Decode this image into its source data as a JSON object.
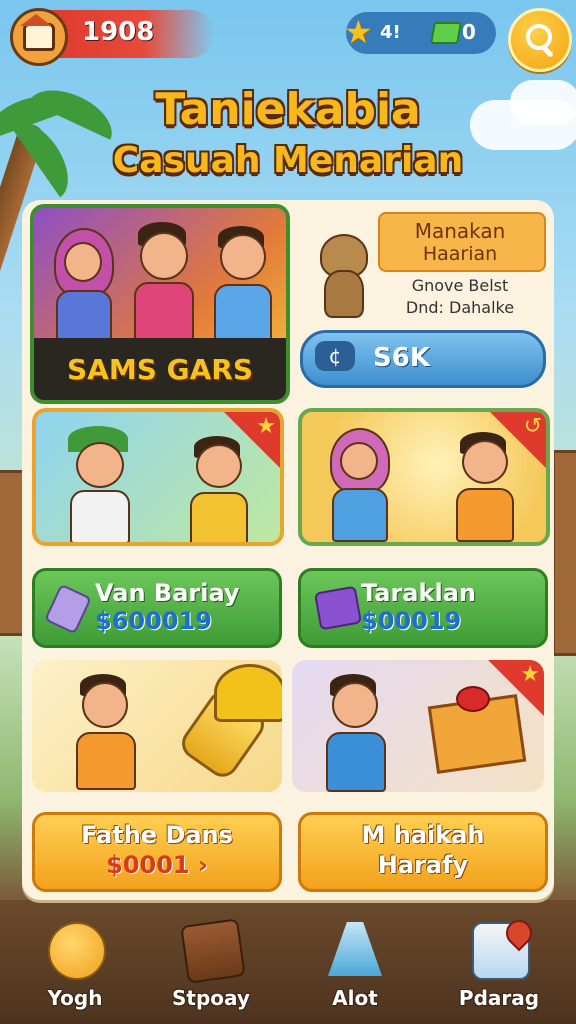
{
  "topbar": {
    "coins": "1908",
    "stars": "4!",
    "gems": "0",
    "icons": [
      "home-icon",
      "star-icon",
      "cash-icon",
      "search-icon"
    ]
  },
  "title": {
    "line1": "Taniekabia",
    "line2": "Casuah Menarian"
  },
  "feature_card": {
    "label": "SAMS GARS"
  },
  "info_card": {
    "tag_line1": "Manakan",
    "tag_line2": "Haarian",
    "desc_line1": "Gnove Belst",
    "desc_line2": "Dnd: Dahalke",
    "button_label": "S6K",
    "button_icon": "coin-icon"
  },
  "deals": [
    {
      "title": "Van Bariay",
      "price": "$600019"
    },
    {
      "title": "Taraklan",
      "price": "$00019"
    }
  ],
  "offers": [
    {
      "line1": "Fathe Dans",
      "line2": "$0001 ›"
    },
    {
      "line1": "M haikah",
      "line2": "Harafy"
    }
  ],
  "nav": [
    {
      "label": "Yogh",
      "icon": "piggy-bank-icon"
    },
    {
      "label": "Stpoay",
      "icon": "suitcase-icon"
    },
    {
      "label": "Alot",
      "icon": "funnel-icon"
    },
    {
      "label": "Pdarag",
      "icon": "map-pin-icon"
    }
  ],
  "colors": {
    "accent": "#f6b81c",
    "green": "#3f9c36",
    "orange": "#f3a21d",
    "blue": "#3e8fd0",
    "red": "#e03a2c"
  }
}
